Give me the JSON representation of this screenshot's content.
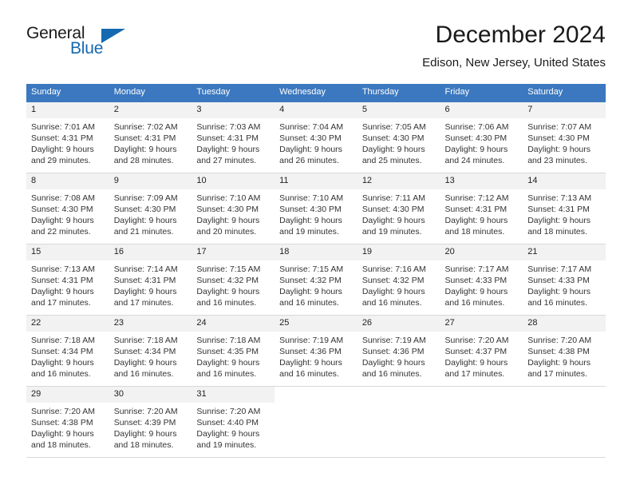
{
  "brand": {
    "name_part1": "General",
    "name_part2": "Blue",
    "accent_color": "#1569b0"
  },
  "header": {
    "title": "December 2024",
    "subtitle": "Edison, New Jersey, United States"
  },
  "theme": {
    "header_bg": "#3b78bf",
    "daynum_bg": "#f2f2f2",
    "text": "#333333"
  },
  "weekday_headers": [
    "Sunday",
    "Monday",
    "Tuesday",
    "Wednesday",
    "Thursday",
    "Friday",
    "Saturday"
  ],
  "weeks": [
    [
      {
        "day": "1",
        "sunrise": "Sunrise: 7:01 AM",
        "sunset": "Sunset: 4:31 PM",
        "daylight1": "Daylight: 9 hours",
        "daylight2": "and 29 minutes."
      },
      {
        "day": "2",
        "sunrise": "Sunrise: 7:02 AM",
        "sunset": "Sunset: 4:31 PM",
        "daylight1": "Daylight: 9 hours",
        "daylight2": "and 28 minutes."
      },
      {
        "day": "3",
        "sunrise": "Sunrise: 7:03 AM",
        "sunset": "Sunset: 4:31 PM",
        "daylight1": "Daylight: 9 hours",
        "daylight2": "and 27 minutes."
      },
      {
        "day": "4",
        "sunrise": "Sunrise: 7:04 AM",
        "sunset": "Sunset: 4:30 PM",
        "daylight1": "Daylight: 9 hours",
        "daylight2": "and 26 minutes."
      },
      {
        "day": "5",
        "sunrise": "Sunrise: 7:05 AM",
        "sunset": "Sunset: 4:30 PM",
        "daylight1": "Daylight: 9 hours",
        "daylight2": "and 25 minutes."
      },
      {
        "day": "6",
        "sunrise": "Sunrise: 7:06 AM",
        "sunset": "Sunset: 4:30 PM",
        "daylight1": "Daylight: 9 hours",
        "daylight2": "and 24 minutes."
      },
      {
        "day": "7",
        "sunrise": "Sunrise: 7:07 AM",
        "sunset": "Sunset: 4:30 PM",
        "daylight1": "Daylight: 9 hours",
        "daylight2": "and 23 minutes."
      }
    ],
    [
      {
        "day": "8",
        "sunrise": "Sunrise: 7:08 AM",
        "sunset": "Sunset: 4:30 PM",
        "daylight1": "Daylight: 9 hours",
        "daylight2": "and 22 minutes."
      },
      {
        "day": "9",
        "sunrise": "Sunrise: 7:09 AM",
        "sunset": "Sunset: 4:30 PM",
        "daylight1": "Daylight: 9 hours",
        "daylight2": "and 21 minutes."
      },
      {
        "day": "10",
        "sunrise": "Sunrise: 7:10 AM",
        "sunset": "Sunset: 4:30 PM",
        "daylight1": "Daylight: 9 hours",
        "daylight2": "and 20 minutes."
      },
      {
        "day": "11",
        "sunrise": "Sunrise: 7:10 AM",
        "sunset": "Sunset: 4:30 PM",
        "daylight1": "Daylight: 9 hours",
        "daylight2": "and 19 minutes."
      },
      {
        "day": "12",
        "sunrise": "Sunrise: 7:11 AM",
        "sunset": "Sunset: 4:30 PM",
        "daylight1": "Daylight: 9 hours",
        "daylight2": "and 19 minutes."
      },
      {
        "day": "13",
        "sunrise": "Sunrise: 7:12 AM",
        "sunset": "Sunset: 4:31 PM",
        "daylight1": "Daylight: 9 hours",
        "daylight2": "and 18 minutes."
      },
      {
        "day": "14",
        "sunrise": "Sunrise: 7:13 AM",
        "sunset": "Sunset: 4:31 PM",
        "daylight1": "Daylight: 9 hours",
        "daylight2": "and 18 minutes."
      }
    ],
    [
      {
        "day": "15",
        "sunrise": "Sunrise: 7:13 AM",
        "sunset": "Sunset: 4:31 PM",
        "daylight1": "Daylight: 9 hours",
        "daylight2": "and 17 minutes."
      },
      {
        "day": "16",
        "sunrise": "Sunrise: 7:14 AM",
        "sunset": "Sunset: 4:31 PM",
        "daylight1": "Daylight: 9 hours",
        "daylight2": "and 17 minutes."
      },
      {
        "day": "17",
        "sunrise": "Sunrise: 7:15 AM",
        "sunset": "Sunset: 4:32 PM",
        "daylight1": "Daylight: 9 hours",
        "daylight2": "and 16 minutes."
      },
      {
        "day": "18",
        "sunrise": "Sunrise: 7:15 AM",
        "sunset": "Sunset: 4:32 PM",
        "daylight1": "Daylight: 9 hours",
        "daylight2": "and 16 minutes."
      },
      {
        "day": "19",
        "sunrise": "Sunrise: 7:16 AM",
        "sunset": "Sunset: 4:32 PM",
        "daylight1": "Daylight: 9 hours",
        "daylight2": "and 16 minutes."
      },
      {
        "day": "20",
        "sunrise": "Sunrise: 7:17 AM",
        "sunset": "Sunset: 4:33 PM",
        "daylight1": "Daylight: 9 hours",
        "daylight2": "and 16 minutes."
      },
      {
        "day": "21",
        "sunrise": "Sunrise: 7:17 AM",
        "sunset": "Sunset: 4:33 PM",
        "daylight1": "Daylight: 9 hours",
        "daylight2": "and 16 minutes."
      }
    ],
    [
      {
        "day": "22",
        "sunrise": "Sunrise: 7:18 AM",
        "sunset": "Sunset: 4:34 PM",
        "daylight1": "Daylight: 9 hours",
        "daylight2": "and 16 minutes."
      },
      {
        "day": "23",
        "sunrise": "Sunrise: 7:18 AM",
        "sunset": "Sunset: 4:34 PM",
        "daylight1": "Daylight: 9 hours",
        "daylight2": "and 16 minutes."
      },
      {
        "day": "24",
        "sunrise": "Sunrise: 7:18 AM",
        "sunset": "Sunset: 4:35 PM",
        "daylight1": "Daylight: 9 hours",
        "daylight2": "and 16 minutes."
      },
      {
        "day": "25",
        "sunrise": "Sunrise: 7:19 AM",
        "sunset": "Sunset: 4:36 PM",
        "daylight1": "Daylight: 9 hours",
        "daylight2": "and 16 minutes."
      },
      {
        "day": "26",
        "sunrise": "Sunrise: 7:19 AM",
        "sunset": "Sunset: 4:36 PM",
        "daylight1": "Daylight: 9 hours",
        "daylight2": "and 16 minutes."
      },
      {
        "day": "27",
        "sunrise": "Sunrise: 7:20 AM",
        "sunset": "Sunset: 4:37 PM",
        "daylight1": "Daylight: 9 hours",
        "daylight2": "and 17 minutes."
      },
      {
        "day": "28",
        "sunrise": "Sunrise: 7:20 AM",
        "sunset": "Sunset: 4:38 PM",
        "daylight1": "Daylight: 9 hours",
        "daylight2": "and 17 minutes."
      }
    ],
    [
      {
        "day": "29",
        "sunrise": "Sunrise: 7:20 AM",
        "sunset": "Sunset: 4:38 PM",
        "daylight1": "Daylight: 9 hours",
        "daylight2": "and 18 minutes."
      },
      {
        "day": "30",
        "sunrise": "Sunrise: 7:20 AM",
        "sunset": "Sunset: 4:39 PM",
        "daylight1": "Daylight: 9 hours",
        "daylight2": "and 18 minutes."
      },
      {
        "day": "31",
        "sunrise": "Sunrise: 7:20 AM",
        "sunset": "Sunset: 4:40 PM",
        "daylight1": "Daylight: 9 hours",
        "daylight2": "and 19 minutes."
      },
      {
        "day": "",
        "sunrise": "",
        "sunset": "",
        "daylight1": "",
        "daylight2": ""
      },
      {
        "day": "",
        "sunrise": "",
        "sunset": "",
        "daylight1": "",
        "daylight2": ""
      },
      {
        "day": "",
        "sunrise": "",
        "sunset": "",
        "daylight1": "",
        "daylight2": ""
      },
      {
        "day": "",
        "sunrise": "",
        "sunset": "",
        "daylight1": "",
        "daylight2": ""
      }
    ]
  ]
}
